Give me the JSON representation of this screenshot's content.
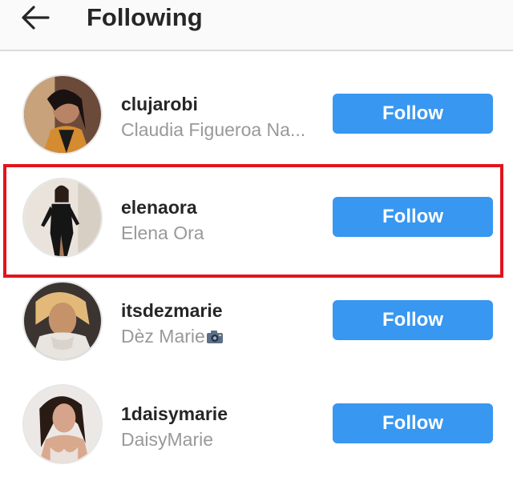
{
  "header": {
    "title": "Following",
    "back_icon": "back-arrow-icon"
  },
  "users": [
    {
      "username": "clujarobi",
      "full_name": "Claudia Figueroa Na...",
      "button_label": "Follow",
      "has_camera_emoji": false
    },
    {
      "username": "elenaora",
      "full_name": "Elena Ora",
      "button_label": "Follow",
      "has_camera_emoji": false,
      "highlighted": true
    },
    {
      "username": "itsdezmarie",
      "full_name": "Dèz Marie",
      "button_label": "Follow",
      "has_camera_emoji": true
    },
    {
      "username": "1daisymarie",
      "full_name": "DaisyMarie",
      "button_label": "Follow",
      "has_camera_emoji": false
    }
  ],
  "colors": {
    "accent": "#3897f0",
    "highlight": "#e0161d",
    "username_text": "#262626",
    "fullname_text": "#999999"
  }
}
